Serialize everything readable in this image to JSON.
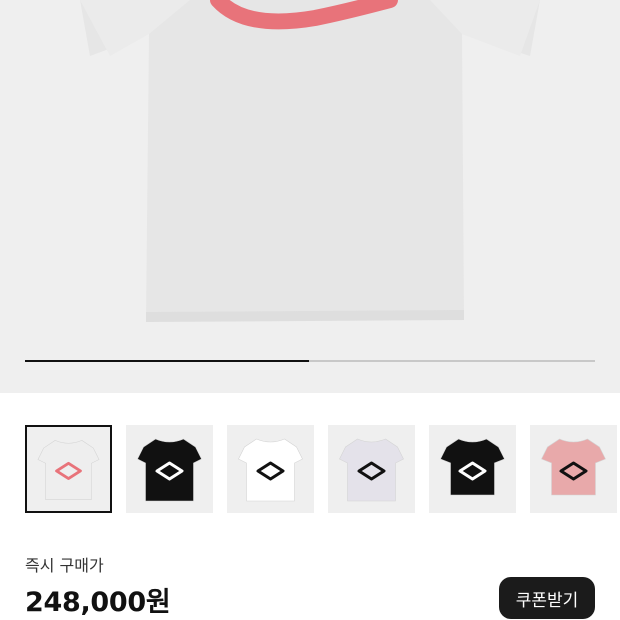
{
  "gallery": {
    "progress": 0.5,
    "thumbnails": [
      {
        "label": "light-gray-tee-pink-logo",
        "shirt": "#eeeeee",
        "logo": "#e8737a",
        "selected": true
      },
      {
        "label": "black-tee-white-logo",
        "shirt": "#111111",
        "logo": "#ffffff",
        "selected": false
      },
      {
        "label": "white-tee-black-logo",
        "shirt": "#ffffff",
        "logo": "#111111",
        "selected": false
      },
      {
        "label": "lavender-tee-black-logo",
        "shirt": "#e4e2ea",
        "logo": "#111111",
        "selected": false
      },
      {
        "label": "black-crop-tee-white-logo",
        "shirt": "#111111",
        "logo": "#ffffff",
        "selected": false
      },
      {
        "label": "pink-crop-tee-black-logo",
        "shirt": "#e8a9aa",
        "logo": "#111111",
        "selected": false
      }
    ]
  },
  "purchase": {
    "label": "즉시 구매가",
    "price": "248,000원",
    "coupon_button": "쿠폰받기"
  }
}
